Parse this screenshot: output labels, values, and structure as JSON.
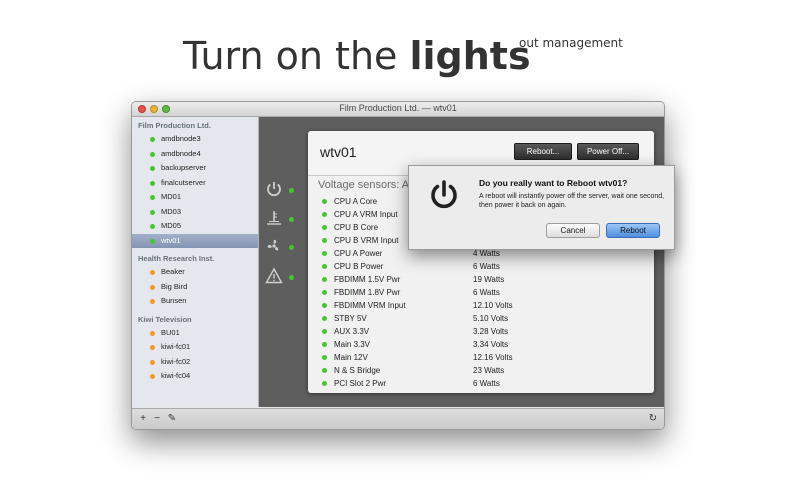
{
  "hero": {
    "prefix": "Turn on the ",
    "bold": "lights",
    "sup": "out management"
  },
  "window": {
    "title": "Film Production Ltd. — wtv01"
  },
  "sidebar": {
    "groups": [
      {
        "name": "Film Production Ltd.",
        "items": [
          {
            "label": "amdbnode3",
            "status": "green"
          },
          {
            "label": "amdbnode4",
            "status": "green"
          },
          {
            "label": "backupserver",
            "status": "green"
          },
          {
            "label": "finalcutserver",
            "status": "green"
          },
          {
            "label": "MD01",
            "status": "green"
          },
          {
            "label": "MD03",
            "status": "green"
          },
          {
            "label": "MD05",
            "status": "green"
          },
          {
            "label": "wtv01",
            "status": "green",
            "selected": true
          }
        ]
      },
      {
        "name": "Health Research Inst.",
        "items": [
          {
            "label": "Beaker",
            "status": "orange"
          },
          {
            "label": "Big Bird",
            "status": "orange"
          },
          {
            "label": "Bunsen",
            "status": "orange"
          }
        ]
      },
      {
        "name": "Kiwi Television",
        "items": [
          {
            "label": "BU01",
            "status": "orange"
          },
          {
            "label": "kiwi-fc01",
            "status": "orange"
          },
          {
            "label": "kiwi-fc02",
            "status": "orange"
          },
          {
            "label": "kiwi-fc04",
            "status": "orange"
          }
        ]
      }
    ]
  },
  "toolbar": {
    "add": "+",
    "remove": "−",
    "edit": "✎",
    "refresh": "↻"
  },
  "panel": {
    "host": "wtv01",
    "reboot_label": "Reboot...",
    "poweroff_label": "Power Off...",
    "sensors_title": "Voltage sensors: Al",
    "sensors": [
      {
        "name": "CPU A Core",
        "value": ""
      },
      {
        "name": "CPU A VRM Input",
        "value": ""
      },
      {
        "name": "CPU B Core",
        "value": ""
      },
      {
        "name": "CPU B VRM Input",
        "value": ""
      },
      {
        "name": "CPU A Power",
        "value": "4 Watts"
      },
      {
        "name": "CPU B Power",
        "value": "6 Watts"
      },
      {
        "name": "FBDIMM 1.5V Pwr",
        "value": "19 Watts"
      },
      {
        "name": "FBDIMM 1.8V Pwr",
        "value": "6 Watts"
      },
      {
        "name": "FBDIMM VRM Input",
        "value": "12.10 Volts"
      },
      {
        "name": "STBY 5V",
        "value": "5.10 Volts"
      },
      {
        "name": "AUX 3.3V",
        "value": "3.28 Volts"
      },
      {
        "name": "Main 3.3V",
        "value": "3.34 Volts"
      },
      {
        "name": "Main 12V",
        "value": "12.16 Volts"
      },
      {
        "name": "N & S Bridge",
        "value": "23 Watts"
      },
      {
        "name": "PCI Slot 2 Pwr",
        "value": "6 Watts"
      }
    ]
  },
  "dialog": {
    "title": "Do you really want to Reboot wtv01?",
    "message": "A reboot will instantly power off the server, wait one second, then power it back on again.",
    "cancel": "Cancel",
    "confirm": "Reboot"
  },
  "colors": {
    "status_green": "#47c52e",
    "status_orange": "#f29b1d",
    "selection": "#8394b3",
    "default_button": "#4e8ee0"
  }
}
